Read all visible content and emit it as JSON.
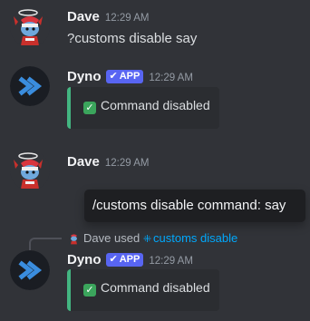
{
  "messages": [
    {
      "author": "Dave",
      "timestamp": "12:29 AM",
      "content": "?customs disable say"
    },
    {
      "author": "Dyno",
      "badge": "APP",
      "timestamp": "12:29 AM",
      "embed_text": "Command disabled"
    },
    {
      "author": "Dave",
      "timestamp": "12:29 AM"
    },
    {
      "author": "Dyno",
      "badge": "APP",
      "timestamp": "12:29 AM",
      "embed_text": "Command disabled",
      "interaction": {
        "user": "Dave",
        "verb": "used",
        "command": "customs disable"
      }
    }
  ],
  "tooltip": {
    "text": "/customs disable command: say"
  },
  "icons": {
    "dave_avatar": "santa-hat-dragon-icon",
    "dyno_avatar": "dyno-chevron-logo-icon",
    "verified_check": "check-icon",
    "embed_check": "green-check-icon",
    "slash_command": "slash-command-icon"
  },
  "colors": {
    "background": "#313338",
    "embed_bg": "#2b2d31",
    "embed_accent": "#43b581",
    "app_badge": "#5865f2",
    "link": "#00a8fc"
  }
}
